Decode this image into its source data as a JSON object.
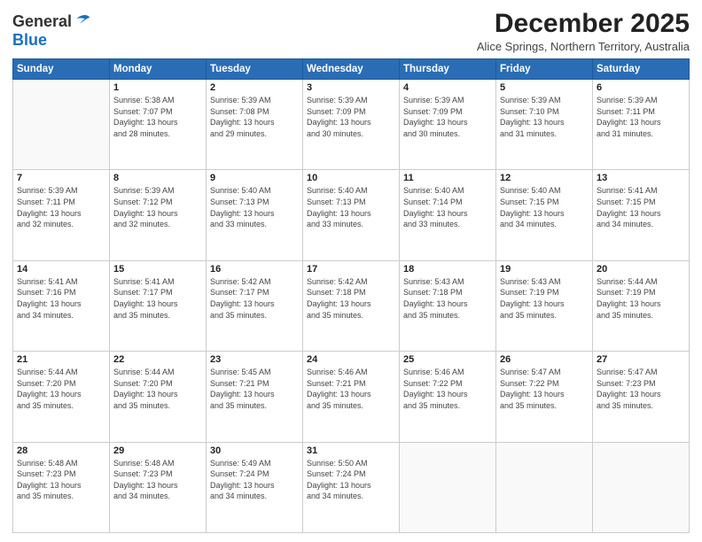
{
  "logo": {
    "general": "General",
    "blue": "Blue"
  },
  "header": {
    "month": "December 2025",
    "subtitle": "Alice Springs, Northern Territory, Australia"
  },
  "weekdays": [
    "Sunday",
    "Monday",
    "Tuesday",
    "Wednesday",
    "Thursday",
    "Friday",
    "Saturday"
  ],
  "weeks": [
    [
      {
        "day": "",
        "info": ""
      },
      {
        "day": "1",
        "info": "Sunrise: 5:38 AM\nSunset: 7:07 PM\nDaylight: 13 hours\nand 28 minutes."
      },
      {
        "day": "2",
        "info": "Sunrise: 5:39 AM\nSunset: 7:08 PM\nDaylight: 13 hours\nand 29 minutes."
      },
      {
        "day": "3",
        "info": "Sunrise: 5:39 AM\nSunset: 7:09 PM\nDaylight: 13 hours\nand 30 minutes."
      },
      {
        "day": "4",
        "info": "Sunrise: 5:39 AM\nSunset: 7:09 PM\nDaylight: 13 hours\nand 30 minutes."
      },
      {
        "day": "5",
        "info": "Sunrise: 5:39 AM\nSunset: 7:10 PM\nDaylight: 13 hours\nand 31 minutes."
      },
      {
        "day": "6",
        "info": "Sunrise: 5:39 AM\nSunset: 7:11 PM\nDaylight: 13 hours\nand 31 minutes."
      }
    ],
    [
      {
        "day": "7",
        "info": "Sunrise: 5:39 AM\nSunset: 7:11 PM\nDaylight: 13 hours\nand 32 minutes."
      },
      {
        "day": "8",
        "info": "Sunrise: 5:39 AM\nSunset: 7:12 PM\nDaylight: 13 hours\nand 32 minutes."
      },
      {
        "day": "9",
        "info": "Sunrise: 5:40 AM\nSunset: 7:13 PM\nDaylight: 13 hours\nand 33 minutes."
      },
      {
        "day": "10",
        "info": "Sunrise: 5:40 AM\nSunset: 7:13 PM\nDaylight: 13 hours\nand 33 minutes."
      },
      {
        "day": "11",
        "info": "Sunrise: 5:40 AM\nSunset: 7:14 PM\nDaylight: 13 hours\nand 33 minutes."
      },
      {
        "day": "12",
        "info": "Sunrise: 5:40 AM\nSunset: 7:15 PM\nDaylight: 13 hours\nand 34 minutes."
      },
      {
        "day": "13",
        "info": "Sunrise: 5:41 AM\nSunset: 7:15 PM\nDaylight: 13 hours\nand 34 minutes."
      }
    ],
    [
      {
        "day": "14",
        "info": "Sunrise: 5:41 AM\nSunset: 7:16 PM\nDaylight: 13 hours\nand 34 minutes."
      },
      {
        "day": "15",
        "info": "Sunrise: 5:41 AM\nSunset: 7:17 PM\nDaylight: 13 hours\nand 35 minutes."
      },
      {
        "day": "16",
        "info": "Sunrise: 5:42 AM\nSunset: 7:17 PM\nDaylight: 13 hours\nand 35 minutes."
      },
      {
        "day": "17",
        "info": "Sunrise: 5:42 AM\nSunset: 7:18 PM\nDaylight: 13 hours\nand 35 minutes."
      },
      {
        "day": "18",
        "info": "Sunrise: 5:43 AM\nSunset: 7:18 PM\nDaylight: 13 hours\nand 35 minutes."
      },
      {
        "day": "19",
        "info": "Sunrise: 5:43 AM\nSunset: 7:19 PM\nDaylight: 13 hours\nand 35 minutes."
      },
      {
        "day": "20",
        "info": "Sunrise: 5:44 AM\nSunset: 7:19 PM\nDaylight: 13 hours\nand 35 minutes."
      }
    ],
    [
      {
        "day": "21",
        "info": "Sunrise: 5:44 AM\nSunset: 7:20 PM\nDaylight: 13 hours\nand 35 minutes."
      },
      {
        "day": "22",
        "info": "Sunrise: 5:44 AM\nSunset: 7:20 PM\nDaylight: 13 hours\nand 35 minutes."
      },
      {
        "day": "23",
        "info": "Sunrise: 5:45 AM\nSunset: 7:21 PM\nDaylight: 13 hours\nand 35 minutes."
      },
      {
        "day": "24",
        "info": "Sunrise: 5:46 AM\nSunset: 7:21 PM\nDaylight: 13 hours\nand 35 minutes."
      },
      {
        "day": "25",
        "info": "Sunrise: 5:46 AM\nSunset: 7:22 PM\nDaylight: 13 hours\nand 35 minutes."
      },
      {
        "day": "26",
        "info": "Sunrise: 5:47 AM\nSunset: 7:22 PM\nDaylight: 13 hours\nand 35 minutes."
      },
      {
        "day": "27",
        "info": "Sunrise: 5:47 AM\nSunset: 7:23 PM\nDaylight: 13 hours\nand 35 minutes."
      }
    ],
    [
      {
        "day": "28",
        "info": "Sunrise: 5:48 AM\nSunset: 7:23 PM\nDaylight: 13 hours\nand 35 minutes."
      },
      {
        "day": "29",
        "info": "Sunrise: 5:48 AM\nSunset: 7:23 PM\nDaylight: 13 hours\nand 34 minutes."
      },
      {
        "day": "30",
        "info": "Sunrise: 5:49 AM\nSunset: 7:24 PM\nDaylight: 13 hours\nand 34 minutes."
      },
      {
        "day": "31",
        "info": "Sunrise: 5:50 AM\nSunset: 7:24 PM\nDaylight: 13 hours\nand 34 minutes."
      },
      {
        "day": "",
        "info": ""
      },
      {
        "day": "",
        "info": ""
      },
      {
        "day": "",
        "info": ""
      }
    ]
  ]
}
